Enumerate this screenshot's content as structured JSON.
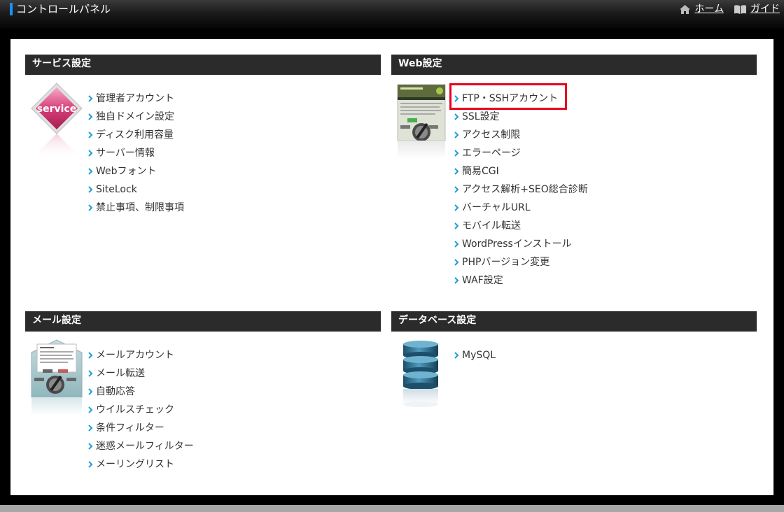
{
  "header": {
    "title": "コントロールパネル",
    "home_label": "ホーム",
    "guide_label": "ガイド"
  },
  "sections": {
    "service": {
      "title": "サービス設定",
      "image_label": "service",
      "items": [
        "管理者アカウント",
        "独自ドメイン設定",
        "ディスク利用容量",
        "サーバー情報",
        "Webフォント",
        "SiteLock",
        "禁止事項、制限事項"
      ]
    },
    "web": {
      "title": "Web設定",
      "items": [
        "FTP・SSHアカウント",
        "SSL設定",
        "アクセス制限",
        "エラーページ",
        "簡易CGI",
        "アクセス解析+SEO総合診断",
        "バーチャルURL",
        "モバイル転送",
        "WordPressインストール",
        "PHPバージョン変更",
        "WAF設定"
      ]
    },
    "mail": {
      "title": "メール設定",
      "items": [
        "メールアカウント",
        "メール転送",
        "自動応答",
        "ウイルスチェック",
        "条件フィルター",
        "迷惑メールフィルター",
        "メーリングリスト"
      ]
    },
    "database": {
      "title": "データベース設定",
      "items": [
        "MySQL"
      ]
    }
  },
  "colors": {
    "accent_blue": "#1e8fff",
    "chevron": "#1a9fd6",
    "highlight": "#e8001c",
    "header_bg": "#2b2b2b"
  }
}
